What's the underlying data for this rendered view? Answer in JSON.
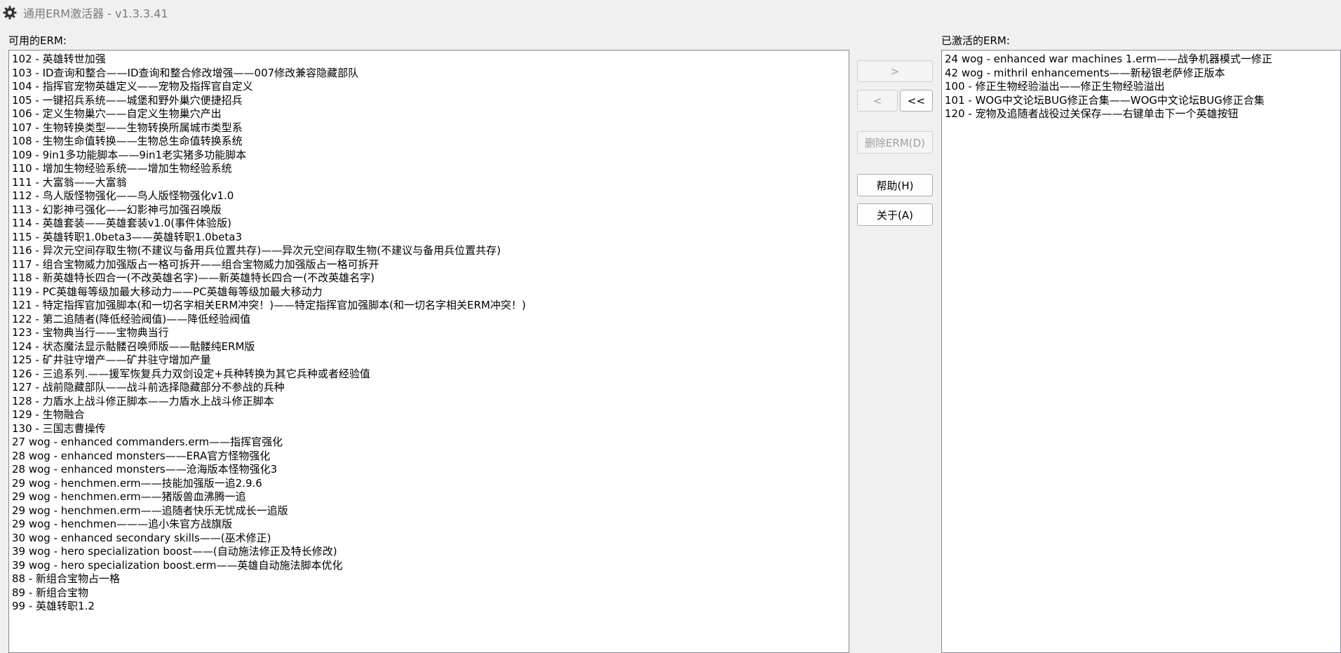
{
  "window": {
    "title": "通用ERM激活器 - v1.3.3.41",
    "icon": "gear-icon"
  },
  "available": {
    "label": "可用的ERM:",
    "items": [
      "102 - 英雄转世加强",
      "103 - ID查询和整合——ID查询和整合修改增强——007修改兼容隐藏部队",
      "104 - 指挥官宠物英雄定义——宠物及指挥官自定义",
      "105 - 一键招兵系统——城堡和野外巢穴便捷招兵",
      "106 - 定义生物巢穴——自定义生物巢穴产出",
      "107 - 生物转换类型——生物转换所属城市类型系",
      "108 - 生物生命值转换——生物总生命值转换系统",
      "109 - 9in1多功能脚本——9in1老实猪多功能脚本",
      "110 - 增加生物经验系统——增加生物经验系统",
      "111 - 大富翁——大富翁",
      "112 - 鸟人版怪物强化——鸟人版怪物强化v1.0",
      "113 - 幻影神弓强化——幻影神弓加强召唤版",
      "114 - 英雄套装——英雄套装v1.0(事件体验版)",
      "115 - 英雄转职1.0beta3——英雄转职1.0beta3",
      "116 - 异次元空间存取生物(不建议与备用兵位置共存)——异次元空间存取生物(不建议与备用兵位置共存)",
      "117 - 组合宝物威力加强版占一格可拆开——组合宝物威力加强版占一格可拆开",
      "118 - 新英雄特长四合一(不改英雄名字)——新英雄特长四合一(不改英雄名字)",
      "119 - PC英雄每等级加最大移动力——PC英雄每等级加最大移动力",
      "121 - 特定指挥官加强脚本(和一切名字相关ERM冲突！)——特定指挥官加强脚本(和一切名字相关ERM冲突！)",
      "122 - 第二追随者(降低经验阀值)——降低经验阀值",
      "123 - 宝物典当行——宝物典当行",
      "124 - 状态魔法显示骷髅召唤师版——骷髅纯ERM版",
      "125 - 矿井驻守增产——矿井驻守增加产量",
      "126 - 三追系列.——援军恢复兵力双剑设定+兵种转换为其它兵种或者经验值",
      "127 - 战前隐藏部队——战斗前选择隐藏部分不参战的兵种",
      "128 - 力盾水上战斗修正脚本——力盾水上战斗修正脚本",
      "129 - 生物融合",
      "130 - 三国志曹操传",
      "27 wog - enhanced commanders.erm——指挥官强化",
      "28 wog - enhanced monsters——ERA官方怪物强化",
      "28 wog - enhanced monsters——沧海版本怪物强化3",
      "29 wog - henchmen.erm——技能加强版一追2.9.6",
      "29 wog - henchmen.erm——猪版兽血沸腾一追",
      "29 wog - henchmen.erm——追随者快乐无忧成长一追版",
      "29 wog - henchmen———追小朱官方战旗版",
      "30 wog - enhanced secondary skills——(巫术修正)",
      "39 wog - hero specialization boost——(自动施法修正及特长修改)",
      "39 wog - hero specialization boost.erm——英雄自动施法脚本优化",
      "88 - 新组合宝物占一格",
      "89 - 新组合宝物",
      "99 - 英雄转职1.2"
    ]
  },
  "active": {
    "label": "已激活的ERM:",
    "items": [
      "24 wog - enhanced war machines 1.erm——战争机器模式一修正",
      "42 wog - mithril enhancements——新秘银老萨修正版本",
      "100 - 修正生物经验溢出——修正生物经验溢出",
      "101 - WOG中文论坛BUG修正合集——WOG中文论坛BUG修正合集",
      "120 - 宠物及追随者战役过关保存——右键单击下一个英雄按钮"
    ]
  },
  "buttons": {
    "activate": ">",
    "deactivate": "<",
    "deactivate_all": "<<",
    "delete": "删除ERM(D)",
    "help": "帮助(H)",
    "about": "关于(A)"
  }
}
